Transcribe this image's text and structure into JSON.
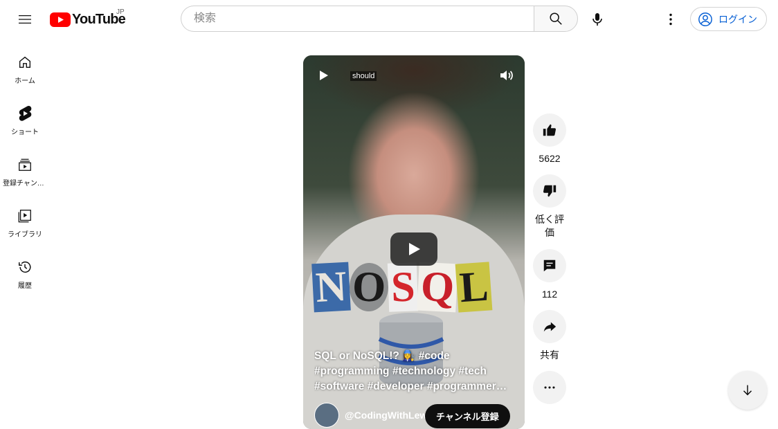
{
  "header": {
    "logo_text": "YouTube",
    "region": "JP",
    "search_placeholder": "検索",
    "login_label": "ログイン"
  },
  "sidebar": {
    "items": [
      {
        "label": "ホーム",
        "icon": "home-icon"
      },
      {
        "label": "ショート",
        "icon": "shorts-icon"
      },
      {
        "label": "登録チャンネル",
        "icon": "subscriptions-icon"
      },
      {
        "label": "ライブラリ",
        "icon": "library-icon"
      },
      {
        "label": "履歴",
        "icon": "history-icon"
      }
    ]
  },
  "video": {
    "caption_word": "should",
    "title_lines": [
      "SQL or NoSQL!? 👩‍🔧 #code",
      "#programming #technology #tech",
      "#software #developer #programmer…"
    ],
    "channel_handle": "@CodingWithLewi",
    "subscribe_label": "チャンネル登録",
    "overlay_text": [
      "N",
      "O",
      "S",
      "Q",
      "L"
    ]
  },
  "actions": {
    "like_count": "5622",
    "dislike_label": "低く評価",
    "comment_count": "112",
    "share_label": "共有"
  },
  "colors": {
    "brand_red": "#ff0000",
    "link_blue": "#065fd4",
    "action_bg": "#f2f2f2"
  }
}
